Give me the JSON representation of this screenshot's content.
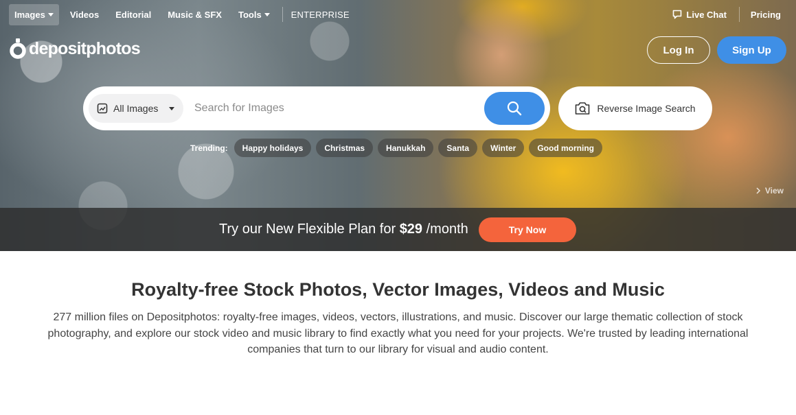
{
  "nav": {
    "items": [
      {
        "label": "Images",
        "active": true,
        "dropdown": true
      },
      {
        "label": "Videos",
        "active": false,
        "dropdown": false
      },
      {
        "label": "Editorial",
        "active": false,
        "dropdown": false
      },
      {
        "label": "Music & SFX",
        "active": false,
        "dropdown": false
      },
      {
        "label": "Tools",
        "active": false,
        "dropdown": true
      }
    ],
    "enterprise": "ENTERPRISE",
    "live_chat": "Live Chat",
    "pricing": "Pricing"
  },
  "logo": {
    "text": "depositphotos"
  },
  "auth": {
    "login": "Log In",
    "signup": "Sign Up"
  },
  "search": {
    "scope": "All Images",
    "placeholder": "Search for Images",
    "reverse_label": "Reverse Image Search"
  },
  "trending": {
    "label": "Trending:",
    "items": [
      "Happy holidays",
      "Christmas",
      "Hanukkah",
      "Santa",
      "Winter",
      "Good morning"
    ]
  },
  "hero": {
    "view_label": "View"
  },
  "promo": {
    "text_before": "Try our New Flexible Plan for ",
    "price": "$29",
    "text_after": " /month",
    "button": "Try Now"
  },
  "content": {
    "title": "Royalty-free Stock Photos, Vector Images, Videos and Music",
    "description": "277 million files on Depositphotos: royalty-free images, videos, vectors, illustrations, and music. Discover our large thematic collection of stock photography, and explore our stock video and music library to find exactly what you need for your projects. We're trusted by leading international companies that turn to our library for visual and audio content."
  },
  "colors": {
    "accent_blue": "#3f8fe6",
    "promo_orange": "#f4643c",
    "text_dark": "#333333"
  }
}
